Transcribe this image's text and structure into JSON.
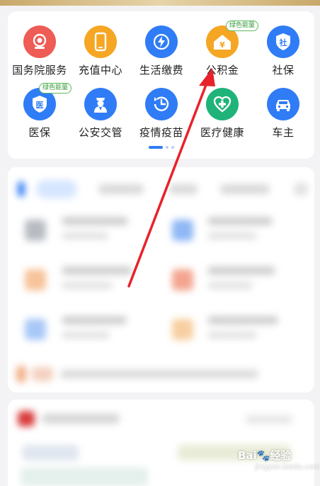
{
  "services": [
    {
      "label": "国务院服务",
      "icon": "seal-icon",
      "color": "#ef5b55",
      "badge": ""
    },
    {
      "label": "充值中心",
      "icon": "phone-icon",
      "color": "#f5a623",
      "badge": ""
    },
    {
      "label": "生活缴费",
      "icon": "lightning-icon",
      "color": "#2f7cf6",
      "badge": ""
    },
    {
      "label": "公积金",
      "icon": "house-yen-icon",
      "color": "#f5a623",
      "badge": "绿色能量"
    },
    {
      "label": "社保",
      "icon": "shield-she-icon",
      "color": "#2f7cf6",
      "badge": ""
    },
    {
      "label": "医保",
      "icon": "shield-yi-icon",
      "color": "#2f7cf6",
      "badge": "绿色能量"
    },
    {
      "label": "公安交管",
      "icon": "police-icon",
      "color": "#2f7cf6",
      "badge": ""
    },
    {
      "label": "疫情疫苗",
      "icon": "clock-history-icon",
      "color": "#2f7cf6",
      "badge": ""
    },
    {
      "label": "医疗健康",
      "icon": "heart-cross-icon",
      "color": "#1fb37a",
      "badge": ""
    },
    {
      "label": "车主",
      "icon": "car-icon",
      "color": "#2f7cf6",
      "badge": ""
    }
  ],
  "icon_glyphs": {
    "yen": "¥",
    "she": "社",
    "yi": "医"
  },
  "watermark": {
    "brand": "Bai",
    "suffix": "经验",
    "url": "jingyan.baidu.com"
  }
}
